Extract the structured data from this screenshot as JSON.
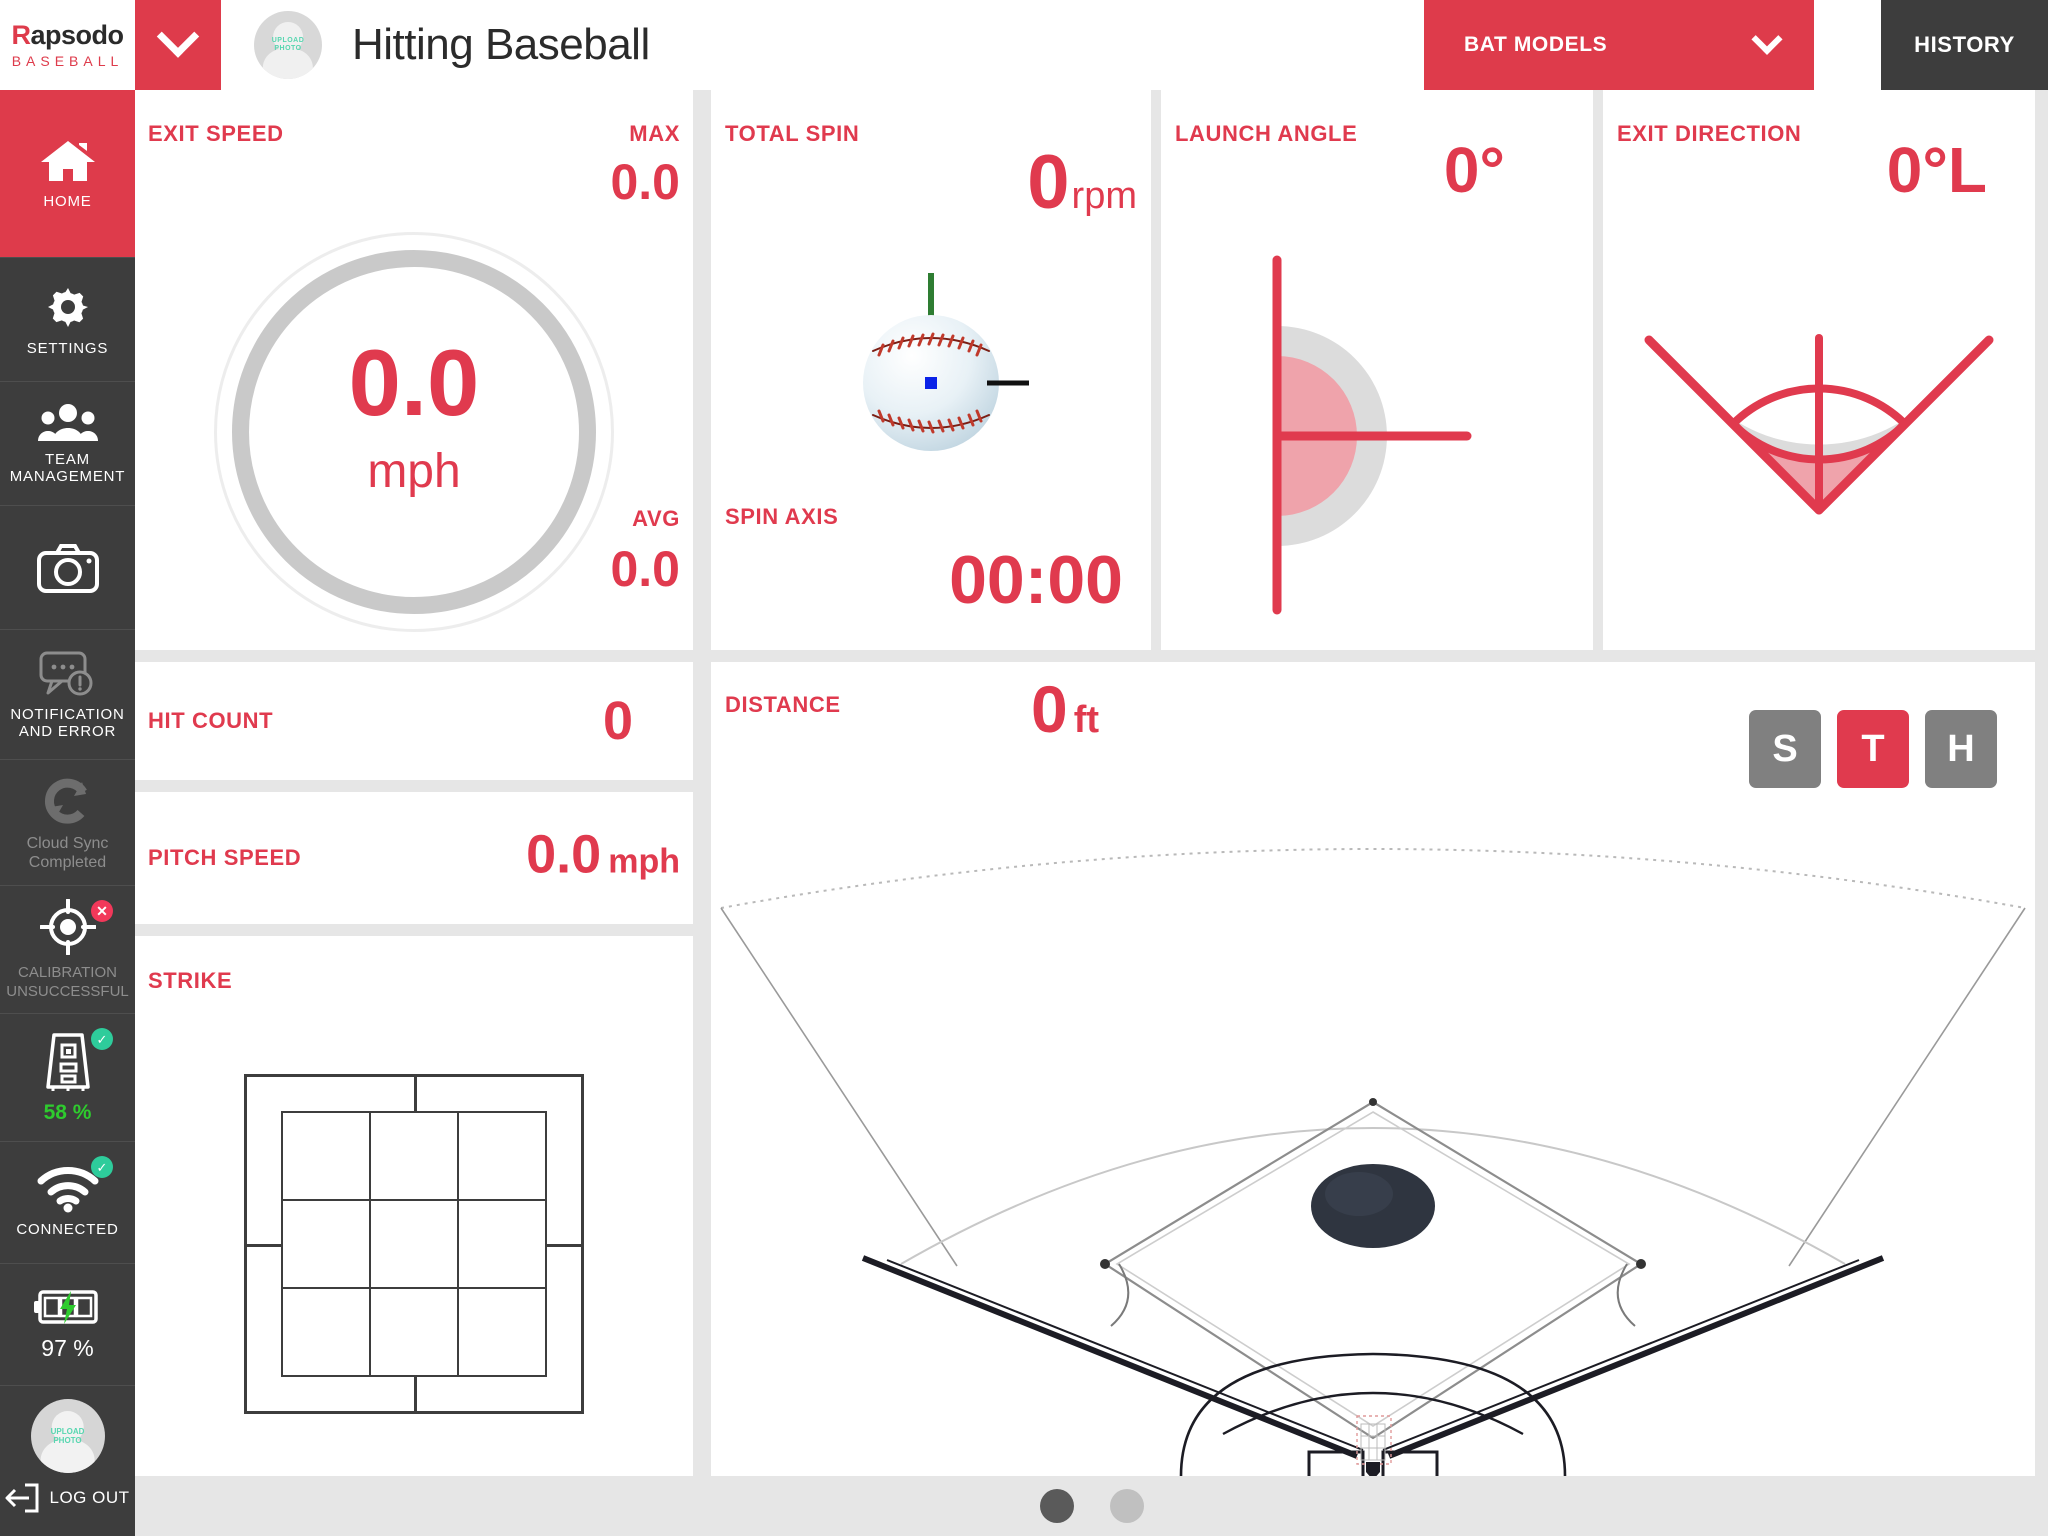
{
  "header": {
    "logo_main": "Rapsodo",
    "logo_main_first": "R",
    "logo_main_rest": "apsodo",
    "logo_sub": "BASEBALL",
    "title": "Hitting Baseball",
    "avatar_upload_line1": "UPLOAD",
    "avatar_upload_line2": "PHOTO",
    "bat_models_label": "BAT MODELS",
    "history_label": "HISTORY"
  },
  "sidebar": {
    "items": [
      {
        "label": "HOME",
        "icon": "home-icon",
        "active": true
      },
      {
        "label": "SETTINGS",
        "icon": "gear-icon",
        "active": false
      },
      {
        "label": "TEAM\nMANAGEMENT",
        "label_line1": "TEAM",
        "label_line2": "MANAGEMENT",
        "icon": "team-icon",
        "active": false
      },
      {
        "label": "",
        "icon": "camera-icon",
        "active": false
      },
      {
        "label_line1": "NOTIFICATION",
        "label_line2": "AND ERROR",
        "icon": "notification-error-icon",
        "active": false
      },
      {
        "label_line1": "Cloud Sync",
        "label_line2": "Completed",
        "icon": "cloud-sync-icon",
        "active": false
      },
      {
        "label_line1": "CALIBRATION",
        "label_line2": "UNSUCCESSFUL",
        "icon": "calibration-target-icon",
        "badge": "error",
        "active": false
      },
      {
        "label": "58 %",
        "icon": "device-icon",
        "badge": "ok",
        "active": false
      },
      {
        "label": "CONNECTED",
        "icon": "wifi-icon",
        "badge": "ok",
        "active": false
      },
      {
        "label": "97 %",
        "icon": "battery-charging-icon",
        "active": false
      }
    ],
    "logout_label": "LOG OUT",
    "avatar_upload_line1": "UPLOAD",
    "avatar_upload_line2": "PHOTO"
  },
  "cards": {
    "exit_speed": {
      "title": "EXIT SPEED",
      "max_label": "MAX",
      "max_value": "0.0",
      "avg_label": "AVG",
      "avg_value": "0.0",
      "gauge_value": "0.0",
      "gauge_unit": "mph"
    },
    "total_spin": {
      "title": "TOTAL SPIN",
      "value": "0",
      "unit": "rpm",
      "spin_axis_label": "SPIN AXIS",
      "spin_axis_value": "00:00"
    },
    "launch_angle": {
      "title": "LAUNCH ANGLE",
      "value": "0°"
    },
    "exit_direction": {
      "title": "EXIT DIRECTION",
      "value": "0°L"
    },
    "hit_count": {
      "title": "HIT COUNT",
      "value": "0"
    },
    "pitch_speed": {
      "title": "PITCH SPEED",
      "value": "0.0",
      "unit": "mph"
    },
    "strike": {
      "title": "STRIKE"
    },
    "distance": {
      "title": "DISTANCE",
      "value": "0",
      "unit": "ft",
      "view_buttons": [
        {
          "label": "S",
          "active": false
        },
        {
          "label": "T",
          "active": true
        },
        {
          "label": "H",
          "active": false
        }
      ]
    }
  },
  "pagination": {
    "dots": 2,
    "active_index": 0
  },
  "colors": {
    "brand_red": "#de3b4b",
    "value_red": "#e03a4e",
    "dark": "#3d3d3d",
    "page_bg": "#e6e6e6",
    "green": "#2ecb2e",
    "badge_green": "#2ecc9b",
    "badge_red": "#f2385a"
  }
}
